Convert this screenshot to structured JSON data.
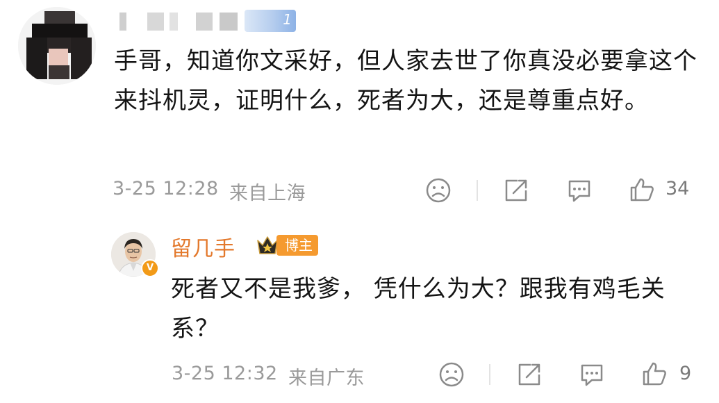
{
  "comment": {
    "username_redacted": true,
    "level_badge": "1",
    "text": "手哥，知道你文采好，但人家去世了你真没必要拿这个来抖机灵，证明什么，死者为大，还是尊重点好。",
    "date_time": "3-25 12:28",
    "location": "来自上海",
    "like_count": "34"
  },
  "reply": {
    "username": "留几手",
    "badge_label": "博主",
    "text": "死者又不是我爹， 凭什么为大？跟我有鸡毛关系？",
    "date_time": "3-25 12:32",
    "location": "来自广东",
    "like_count": "9"
  },
  "icons": {
    "dislike": "sad-face-icon",
    "share": "share-icon",
    "comment": "comment-bubble-icon",
    "like": "thumbs-up-icon",
    "verified": "verified-v-icon",
    "crown": "crown-icon"
  },
  "colors": {
    "accent_name": "#e3782b",
    "badge_orange": "#f59a2f",
    "meta_gray": "#9a9a9a"
  }
}
